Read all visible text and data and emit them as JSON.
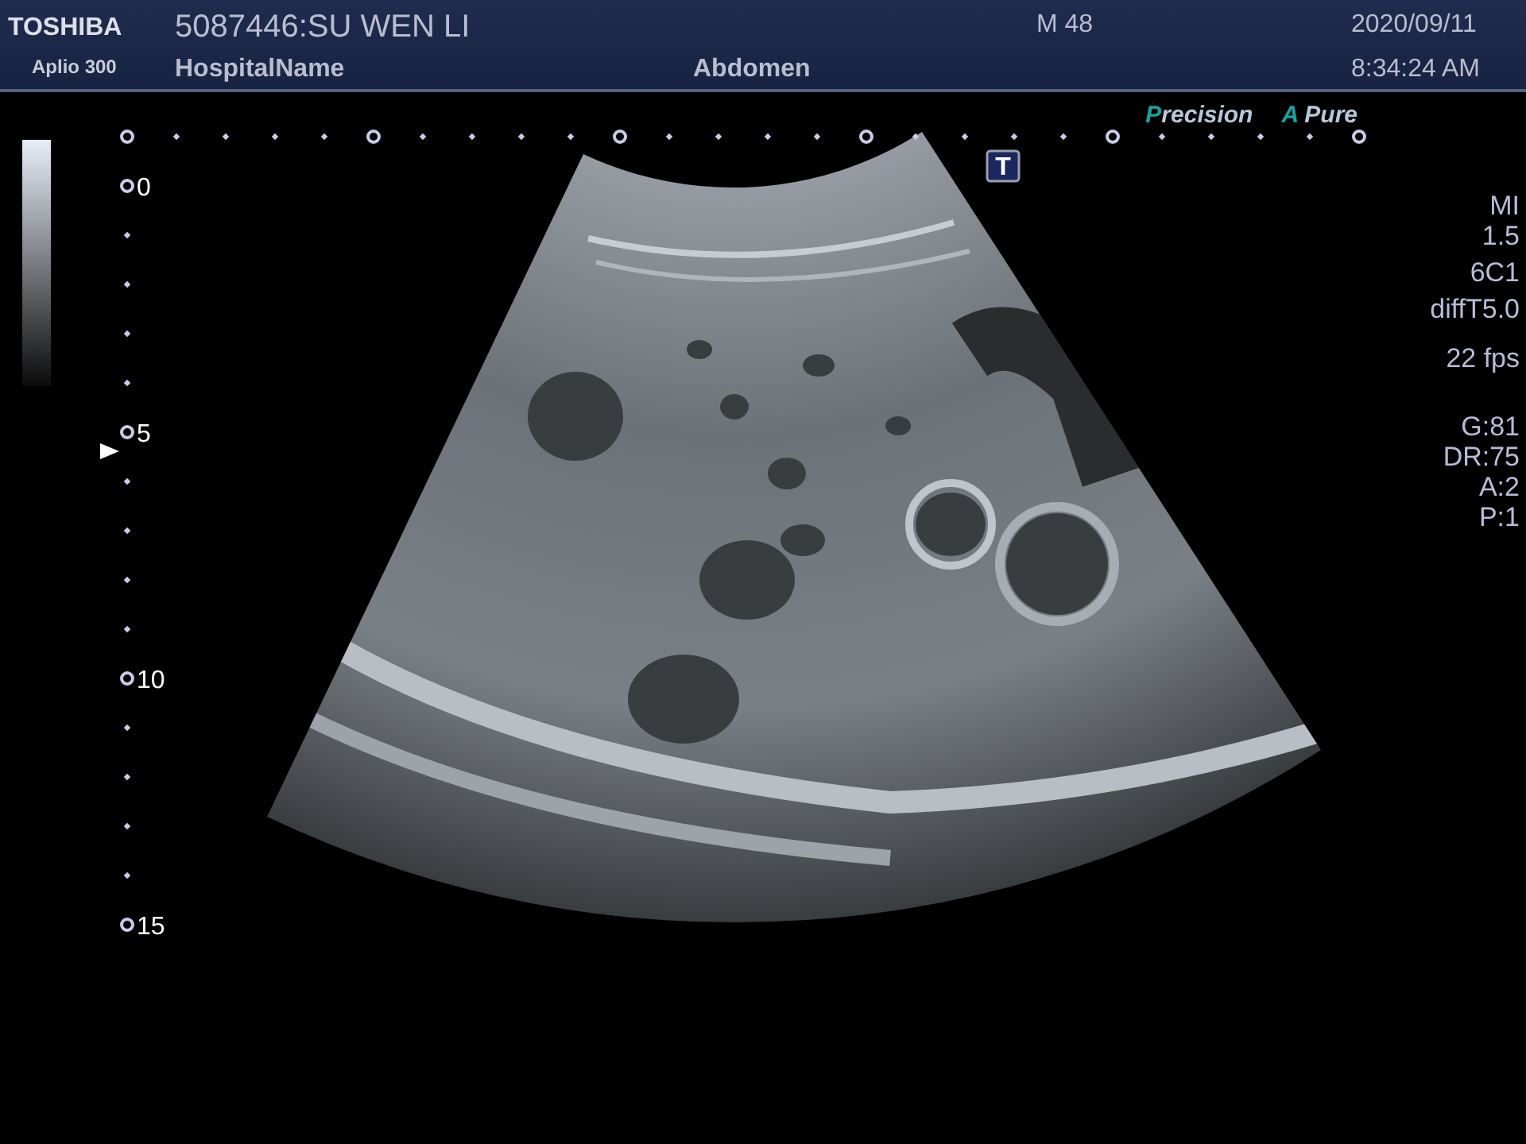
{
  "header": {
    "brand": "TOSHIBA",
    "model": "Aplio 300",
    "patient": "5087446:SU WEN LI",
    "hospital": "HospitalName",
    "exam": "Abdomen",
    "patient_info": "M 48",
    "date": "2020/09/11",
    "time": "8:34:24 AM"
  },
  "logos": [
    "Precision",
    "A Pure"
  ],
  "probe_marker": "T",
  "depth_scale": {
    "labels": [
      "0",
      "5",
      "10",
      "15"
    ]
  },
  "parameters": [
    {
      "lines": [
        "MI",
        "1.5"
      ]
    },
    {
      "lines": [
        "6C1"
      ]
    },
    {
      "lines": [
        "diffT5.0"
      ]
    },
    {
      "lines": [
        "22 fps"
      ]
    },
    {
      "lines": [
        "G:81",
        "DR:75",
        "A:2",
        "P:1"
      ]
    }
  ]
}
